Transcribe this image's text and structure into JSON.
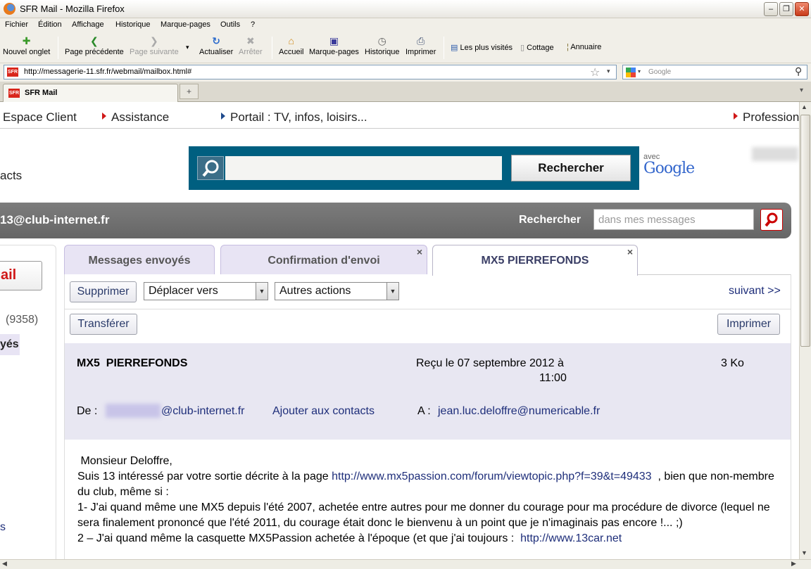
{
  "window": {
    "title": "SFR Mail - Mozilla Firefox"
  },
  "menu": [
    "Fichier",
    "Édition",
    "Affichage",
    "Historique",
    "Marque-pages",
    "Outils",
    "?"
  ],
  "toolbar": {
    "new_tab": "Nouvel onglet",
    "back": "Page précédente",
    "forward": "Page suivante",
    "reload": "Actualiser",
    "stop": "Arrêter",
    "home": "Accueil",
    "bookmarks": "Marque-pages",
    "history": "Historique",
    "print": "Imprimer"
  },
  "bookmarks_bar": [
    "Les plus visités",
    "Cottage",
    "Annuaire"
  ],
  "address": {
    "favicon": "SFR",
    "url": "http://messagerie-11.sfr.fr/webmail/mailbox.html#"
  },
  "search": {
    "placeholder": "Google"
  },
  "browser_tab": {
    "label": "SFR Mail",
    "favicon": "SFR"
  },
  "site_nav": {
    "espace_client": "Espace Client",
    "assistance": "Assistance",
    "portail": "Portail : TV, infos, loisirs...",
    "professionnels": "Profession"
  },
  "left_partial": {
    "contacts": "acts",
    "mail_btn": "ail",
    "count": "(9358)",
    "envoyes": "yés",
    "bottom": "s"
  },
  "google_search": {
    "button": "Rechercher",
    "avec": "avec",
    "logo": "Google"
  },
  "account_bar": {
    "address": "13@club-internet.fr",
    "search_label": "Rechercher",
    "search_placeholder": "dans mes messages"
  },
  "mail_tabs": [
    {
      "label": "Messages envoyés"
    },
    {
      "label": "Confirmation d'envoi",
      "close": "×"
    },
    {
      "label": "MX5 PIERREFONDS",
      "close": "×"
    }
  ],
  "actions": {
    "delete": "Supprimer",
    "move": "Déplacer vers",
    "other": "Autres actions",
    "next": "suivant >>",
    "forward": "Transférer",
    "print": "Imprimer"
  },
  "message": {
    "subject": "MX5  PIERREFONDS",
    "received_line1": "Reçu le 07 septembre 2012 à",
    "received_line2": "11:00",
    "size": "3 Ko",
    "from_label": "De :",
    "from_domain": "@club-internet.fr",
    "add_contact": "Ajouter aux contacts",
    "to_label": "A :",
    "to": "jean.luc.deloffre@numericable.fr",
    "body": {
      "greeting": " Monsieur Deloffre,",
      "p1_start": "Suis 13 intéressé par votre sortie décrite à la page ",
      "p1_link": "http://www.mx5passion.com/forum/viewtopic.php?f=39&t=49433",
      "p1_end": "  , bien que non-membre du club, même si :",
      "p2": "1- J'ai quand même une MX5 depuis l'été 2007, achetée entre autres pour me donner du courage pour ma procédure de divorce (lequel ne sera finalement prononcé que l'été 2011, du courage était donc le bienvenu à un point que je n'imaginais pas encore !...  ;)",
      "p3_start": "2 – J'ai quand même la casquette MX5Passion achetée à l'époque (et que j'ai toujours :  ",
      "p3_link": "http://www.13car.net"
    }
  }
}
